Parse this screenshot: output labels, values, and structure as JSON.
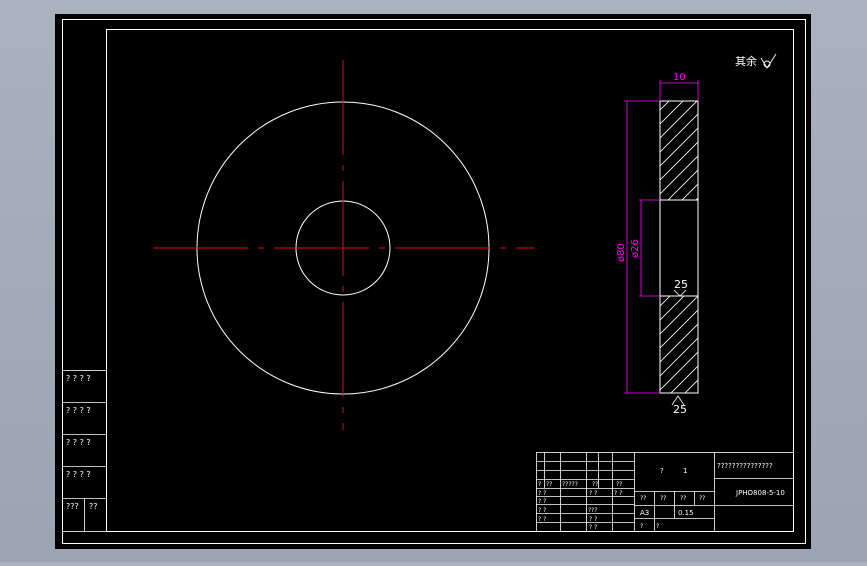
{
  "drawing": {
    "colors": {
      "viewport_bg": "#a9b2bf",
      "paper": "#000000",
      "outline": "#ffffff",
      "centerline": "#e0002a",
      "dimension": "#ff00ff"
    },
    "side_view": {
      "roughness_note": "其余",
      "dim_width": "10",
      "dim_outer_dia": "ø80",
      "dim_inner_dia": "ø26",
      "roughness_top": "25",
      "roughness_bottom": "25"
    },
    "left_sign_strip": [
      "? ? ? ?",
      "? ? ? ?",
      "? ? ? ?",
      "? ? ? ?",
      "???",
      "??"
    ],
    "title_block": {
      "name_row": [
        "?",
        "1"
      ],
      "company": "???????????????",
      "rev_row": [
        "?",
        "??",
        "?????",
        "??",
        "??"
      ],
      "approvals": [
        "? ?",
        "? ?",
        "? ?",
        "? ?"
      ],
      "approval_sig": "???",
      "mid_marks": [
        "? ?",
        "? ?",
        "? ?",
        "? ?"
      ],
      "scale_headers": [
        "??",
        "??",
        "??",
        "??"
      ],
      "drawing_number": "JPHO808-5-10",
      "paper_size": "A3",
      "scale": "0.15",
      "bottom_marks": [
        "?",
        "?"
      ]
    }
  }
}
